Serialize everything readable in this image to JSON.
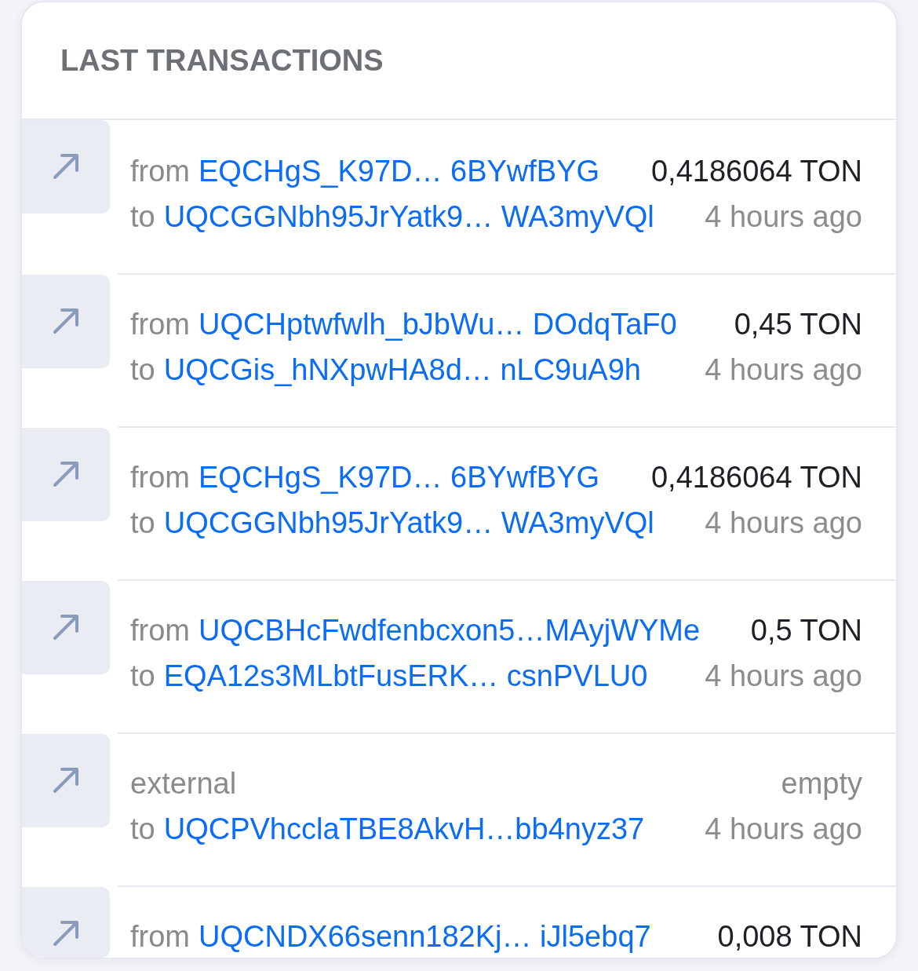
{
  "card": {
    "title": "LAST TRANSACTIONS"
  },
  "transactions": [
    {
      "source": {
        "kind": "address",
        "label": "from",
        "address": "EQCHgS_K97D… 6BYwfBYG"
      },
      "destination": {
        "label": "to",
        "address": "UQCGGNbh95JrYatk9… WA3myVQl"
      },
      "amount": {
        "text": "0,4186064 TON",
        "empty": false
      },
      "time": "4 hours ago"
    },
    {
      "source": {
        "kind": "address",
        "label": "from",
        "address": "UQCHptwfwlh_bJbWu… DOdqTaF0"
      },
      "destination": {
        "label": "to",
        "address": "UQCGis_hNXpwHA8d… nLC9uA9h"
      },
      "amount": {
        "text": "0,45 TON",
        "empty": false
      },
      "time": "4 hours ago"
    },
    {
      "source": {
        "kind": "address",
        "label": "from",
        "address": "EQCHgS_K97D… 6BYwfBYG"
      },
      "destination": {
        "label": "to",
        "address": "UQCGGNbh95JrYatk9… WA3myVQl"
      },
      "amount": {
        "text": "0,4186064 TON",
        "empty": false
      },
      "time": "4 hours ago"
    },
    {
      "source": {
        "kind": "address",
        "label": "from",
        "address": "UQCBHcFwdfenbcxon5…MAyjWYMe"
      },
      "destination": {
        "label": "to",
        "address": "EQA12s3MLbtFusERK… csnPVLU0"
      },
      "amount": {
        "text": "0,5 TON",
        "empty": false
      },
      "time": "4 hours ago"
    },
    {
      "source": {
        "kind": "external",
        "label": "external"
      },
      "destination": {
        "label": "to",
        "address": "UQCPVhcclaTBE8AkvH…bb4nyz37"
      },
      "amount": {
        "text": "empty",
        "empty": true
      },
      "time": "4 hours ago"
    },
    {
      "source": {
        "kind": "address",
        "label": "from",
        "address": "UQCNDX66senn182Kj… iJl5ebq7"
      },
      "amount": {
        "text": "0,008 TON",
        "empty": false
      }
    }
  ]
}
